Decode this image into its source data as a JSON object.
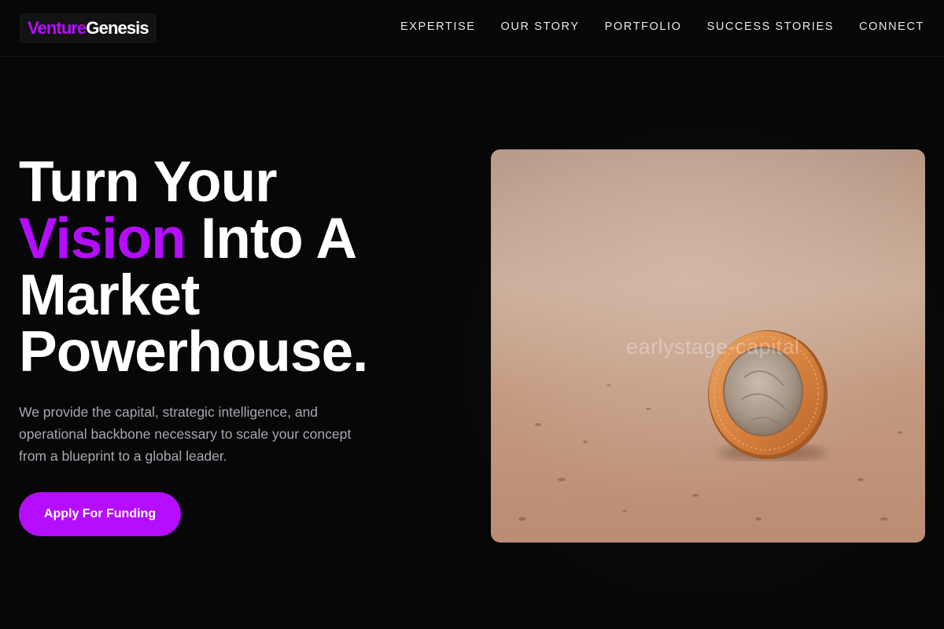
{
  "brand": {
    "part1": "Venture",
    "part2": "Genesis"
  },
  "nav": [
    {
      "label": "EXPERTISE"
    },
    {
      "label": "OUR STORY"
    },
    {
      "label": "PORTFOLIO"
    },
    {
      "label": "SUCCESS STORIES"
    },
    {
      "label": "CONNECT"
    }
  ],
  "hero": {
    "line1": "Turn Your",
    "accent_word": "Vision",
    "line2_rest": " Into A",
    "line3": "Market",
    "line4": "Powerhouse.",
    "subtext": "We provide the capital, strategic intelligence, and operational backbone necessary to scale your concept from a blueprint to a global leader.",
    "cta_label": "Apply For Funding",
    "image_watermark": "earlystage-capital"
  },
  "colors": {
    "accent": "#b40dff",
    "background": "#070707",
    "subtext": "#a7a7b2"
  },
  "icons": {
    "hero_image": "coin-on-sand-photo"
  }
}
